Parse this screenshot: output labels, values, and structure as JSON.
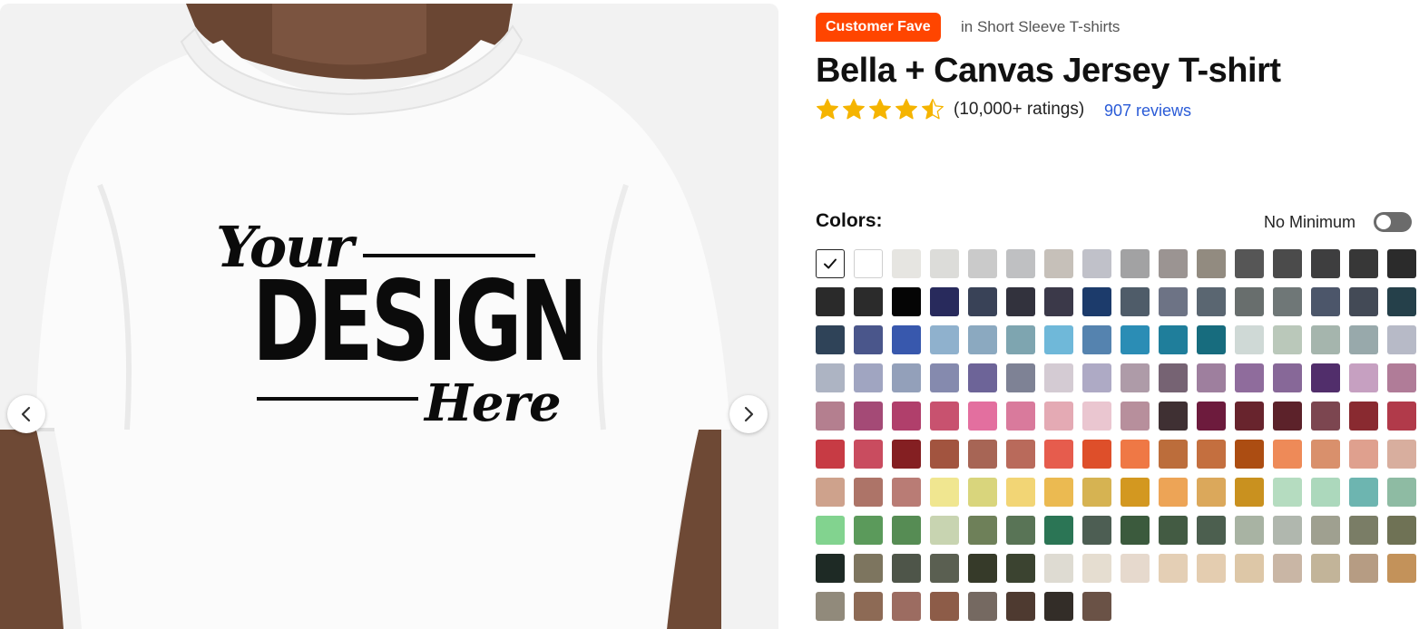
{
  "product": {
    "badge": "Customer Fave",
    "category_text": "in Short Sleeve T-shirts",
    "title": "Bella + Canvas Jersey T-shirt",
    "rating_value": 4.5,
    "ratings_text": "(10,000+ ratings)",
    "reviews_text": "907 reviews",
    "star_color": "#f5b400"
  },
  "image": {
    "design_top": "Your",
    "design_main": "DESIGN",
    "design_bottom": "Here",
    "prev_icon": "chevron-left-icon",
    "next_icon": "chevron-right-icon"
  },
  "colors": {
    "label": "Colors:",
    "no_minimum_label": "No Minimum",
    "no_minimum_on": false,
    "selected_index": 0,
    "swatches": [
      "#ffffff",
      "#ffffff",
      "#e6e5e1",
      "#dcdcd9",
      "#cacaca",
      "#bfc0c2",
      "#c6c0b9",
      "#c0c1c9",
      "#a2a2a3",
      "#9b9492",
      "#928b80",
      "#565656",
      "#4b4b4b",
      "#3e3e3f",
      "#373737",
      "#2b2b2b",
      "#2a2a2a",
      "#2b2b2b",
      "#050505",
      "#282a5c",
      "#394257",
      "#32323d",
      "#3b3949",
      "#1c3b6b",
      "#4f5c69",
      "#6d7385",
      "#5a6671",
      "#686e6d",
      "#6f7777",
      "#4c566a",
      "#434a56",
      "#25404a",
      "#2f4358",
      "#4a568b",
      "#3858ad",
      "#8fb1cd",
      "#8ba9c0",
      "#7ea5b0",
      "#6fb8d9",
      "#5583af",
      "#2b8db5",
      "#1f7e9b",
      "#176c7e",
      "#cfd9d6",
      "#bac8ba",
      "#a5b5ad",
      "#98a9ab",
      "#b7bac7",
      "#adb4c3",
      "#a0a5c1",
      "#93a0ba",
      "#858aae",
      "#6d6498",
      "#7e8295",
      "#d4cbd3",
      "#aeaac5",
      "#ae9ba8",
      "#766373",
      "#9e7f9e",
      "#8f6c9c",
      "#876898",
      "#512e6b",
      "#c6a0c1",
      "#b07c98",
      "#b47f8f",
      "#a44a76",
      "#b03f6b",
      "#c8526f",
      "#e36f9f",
      "#d97a9c",
      "#e4aab4",
      "#eac6d0",
      "#b78f9c",
      "#3f3033",
      "#6d1b3d",
      "#68242d",
      "#5c222a",
      "#7c4650",
      "#892a30",
      "#b13a4a",
      "#c73b44",
      "#c94c5f",
      "#841f22",
      "#a2543f",
      "#a76555",
      "#b96a5b",
      "#e65c4d",
      "#de4f2a",
      "#ef7845",
      "#bc6d3b",
      "#c46f3f",
      "#ac4d12",
      "#ee8a58",
      "#d9906c",
      "#dfa08e",
      "#d8ae9e",
      "#cea28c",
      "#ad7468",
      "#b97c75",
      "#f0e690",
      "#d9d57c",
      "#f2d575",
      "#ebba51",
      "#d6b352",
      "#d39820",
      "#eda456",
      "#dba85b",
      "#c9911f",
      "#b5dcc0",
      "#acd8bc",
      "#6db5b0",
      "#8ebba3",
      "#82d38f",
      "#5b9a5b",
      "#568c54",
      "#c8d4b1",
      "#6e8059",
      "#597456",
      "#2b7555",
      "#4d5e53",
      "#3b5a3d",
      "#435b43",
      "#4c5f4f",
      "#a8b3a3",
      "#b0b7ae",
      "#9fa090",
      "#7a7d66",
      "#6f7255",
      "#1e2a25",
      "#7d755f",
      "#4e5549",
      "#5a5f51",
      "#363a29",
      "#3b4330",
      "#dedbd2",
      "#e5ddd0",
      "#e6d9cd",
      "#e4cfb5",
      "#e4cdb0",
      "#ddc7a7",
      "#c9b6a5",
      "#c2b499",
      "#b69c83",
      "#c3925a",
      "#918a7b",
      "#8d6a55",
      "#9c6c61",
      "#8d5c48",
      "#756961",
      "#4e3a30",
      "#332d28",
      "#6a5246"
    ]
  }
}
